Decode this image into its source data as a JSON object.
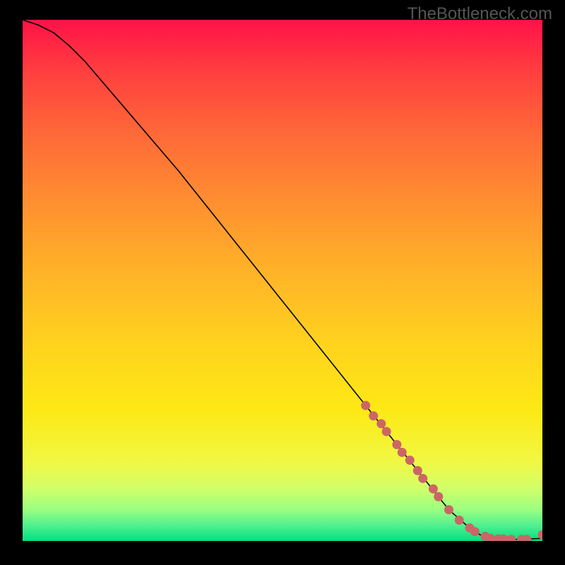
{
  "attribution": "TheBottleneck.com",
  "chart_data": {
    "type": "line",
    "title": "",
    "xlabel": "",
    "ylabel": "",
    "xlim": [
      0,
      100
    ],
    "ylim": [
      0,
      100
    ],
    "grid": false,
    "curve": {
      "name": "curve",
      "x": [
        0,
        3,
        6,
        9,
        12,
        18,
        24,
        30,
        36,
        42,
        48,
        54,
        60,
        66,
        72,
        78,
        82,
        86,
        88,
        90,
        95,
        100
      ],
      "y": [
        100,
        99,
        97.5,
        95,
        92,
        85,
        78,
        71,
        63.5,
        56,
        48.5,
        41,
        33.5,
        26,
        18.5,
        11,
        6,
        2.5,
        1.2,
        0.5,
        0.3,
        0.5
      ]
    },
    "highlighted_points": {
      "name": "highlighted",
      "color": "#cc6666",
      "points": [
        {
          "x": 66,
          "y": 26
        },
        {
          "x": 67.5,
          "y": 24
        },
        {
          "x": 69,
          "y": 22.5
        },
        {
          "x": 70,
          "y": 21
        },
        {
          "x": 72,
          "y": 18.5
        },
        {
          "x": 73,
          "y": 17
        },
        {
          "x": 74.5,
          "y": 15.5
        },
        {
          "x": 76,
          "y": 13.5
        },
        {
          "x": 77,
          "y": 12
        },
        {
          "x": 79,
          "y": 10
        },
        {
          "x": 80,
          "y": 8.5
        },
        {
          "x": 82,
          "y": 6
        },
        {
          "x": 84,
          "y": 4
        },
        {
          "x": 86,
          "y": 2.5
        },
        {
          "x": 87,
          "y": 1.8
        },
        {
          "x": 89,
          "y": 0.9
        },
        {
          "x": 90,
          "y": 0.5
        },
        {
          "x": 91.5,
          "y": 0.4
        },
        {
          "x": 92.5,
          "y": 0.4
        },
        {
          "x": 94,
          "y": 0.3
        },
        {
          "x": 96,
          "y": 0.3
        },
        {
          "x": 97,
          "y": 0.3
        },
        {
          "x": 100,
          "y": 1.2
        }
      ]
    }
  }
}
